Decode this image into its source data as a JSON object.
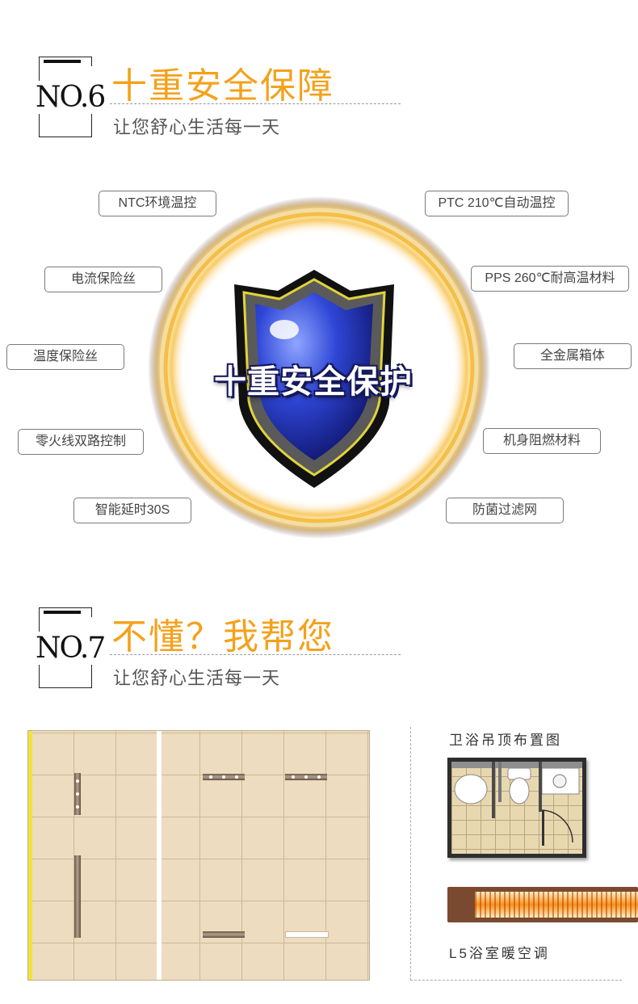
{
  "section6": {
    "number": "NO.6",
    "title": "十重安全保障",
    "subtitle": "让您舒心生活每一天",
    "shield_text": "十重安全保护",
    "features_left": [
      "NTC环境温控",
      "电流保险丝",
      "温度保险丝",
      "零火线双路控制",
      "智能延时30S"
    ],
    "features_right": [
      "PTC 210℃自动温控",
      "PPS 260℃耐高温材料",
      "全金属箱体",
      "机身阻燃材料",
      "防菌过滤网"
    ]
  },
  "section7": {
    "number": "NO.7",
    "title": "不懂？我帮您",
    "subtitle": "让您舒心生活每一天",
    "layout_label": "卫浴吊顶布置图",
    "product_label": "L5浴室暖空调"
  },
  "colors": {
    "accent": "#f4a11c",
    "shield_blue": "#2a3fc4",
    "ring_gold": "#f2b634"
  },
  "icons": {
    "shield": "shield-icon"
  }
}
